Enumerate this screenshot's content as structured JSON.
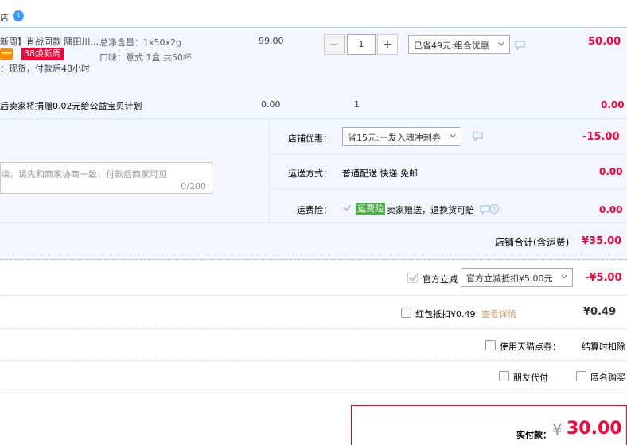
{
  "shop": {
    "name_fragment": "店",
    "badge": "1"
  },
  "item": {
    "title": "新周】肖战同款 隅田川...",
    "tag": "38焕新周",
    "delivery": "：现货，付款后48小时",
    "spec_weight": "总净含量：1x50x2g",
    "spec_flavor": "口味：意式 1盒 共50杯",
    "unit_price": "99.00",
    "quantity": "1",
    "qty_minus": "−",
    "qty_plus": "+",
    "promo_select": "已省49元:组合优惠",
    "subtotal": "50.00"
  },
  "charity": {
    "text": "后卖家将捐赠0.02元给公益宝贝计划",
    "price": "0.00",
    "quantity": "1",
    "subtotal": "0.00"
  },
  "message": {
    "placeholder": "填，请先和商家协商一致，付款后商家可见",
    "counter": "0/200"
  },
  "shop_discount": {
    "label": "店铺优惠：",
    "select": "省15元:一发入魂冲刺券",
    "amount": "-15.00"
  },
  "shipping": {
    "label": "运送方式：",
    "value": "普通配送 快递 免邮",
    "amount": "0.00"
  },
  "insurance": {
    "label": "运费险：",
    "tag": "运费险",
    "text": "卖家赠送，退换货可赔",
    "amount": "0.00"
  },
  "shop_total": {
    "label": "店铺合计(含运费)",
    "amount": "¥35.00"
  },
  "official_discount": {
    "label": "官方立减",
    "select": "官方立减抵扣¥5.00元",
    "amount": "-¥5.00"
  },
  "red_packet": {
    "label": "红包抵扣¥0.49",
    "link": "查看详情",
    "amount": "¥0.49"
  },
  "tmall_points": {
    "label": "使用天猫点券：",
    "note": "结算时扣除"
  },
  "options": {
    "friend_pay": "朋友代付",
    "anonymous": "匿名购买"
  },
  "payment": {
    "label": "实付款：",
    "currency": "¥",
    "amount": "30.00"
  },
  "colors": {
    "accent_red": "#ff0036",
    "panel_blue": "#f2f7ff",
    "border_blue": "#b2d1ff",
    "insurance_green": "#4bb046"
  }
}
